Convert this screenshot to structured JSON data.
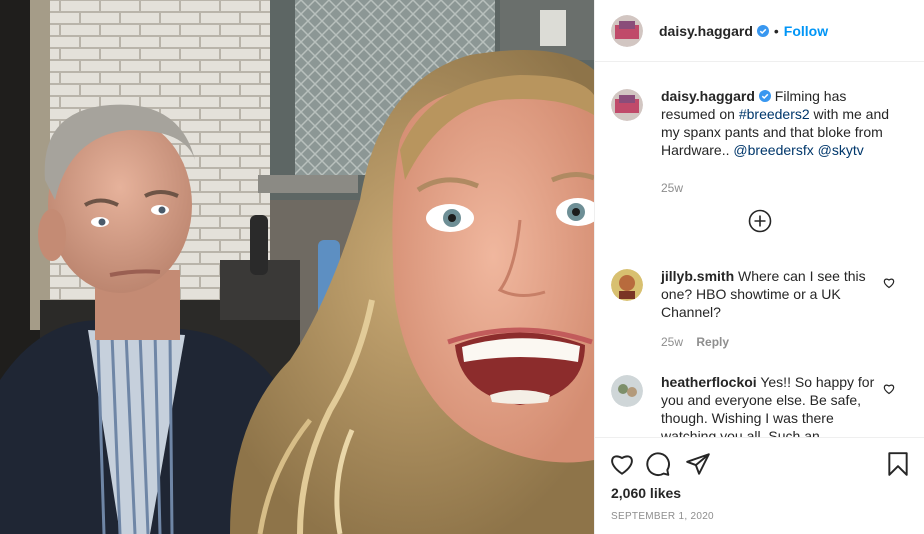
{
  "header": {
    "username": "daisy.haggard",
    "follow_label": "Follow",
    "dot": "•"
  },
  "caption": {
    "username": "daisy.haggard",
    "text_before": "Filming has resumed on ",
    "hashtag": "#breeders2",
    "text_middle": " with me and my spanx pants and that bloke from Hardware..",
    "mention1": "@breedersfx",
    "mention2": "@skytv",
    "age": "25w"
  },
  "comments": [
    {
      "username": "jillyb.smith",
      "text": "Where can I see this one? HBO showtime or a UK Channel?",
      "age": "25w",
      "reply_label": "Reply"
    },
    {
      "username": "heatherflockoi",
      "text": "Yes!! So happy for you and everyone else. Be safe, though. Wishing I was there watching you all. Such an",
      "age": "",
      "reply_label": ""
    }
  ],
  "footer": {
    "likes": "2,060 likes",
    "date": "SEPTEMBER 1, 2020"
  },
  "icons": [
    "verified-icon",
    "load-more-icon",
    "heart-icon",
    "comment-icon",
    "share-icon",
    "bookmark-icon"
  ],
  "colors": {
    "accent": "#0095f6",
    "link": "#00376b",
    "muted": "#8e8e8e",
    "border": "#efefef"
  }
}
